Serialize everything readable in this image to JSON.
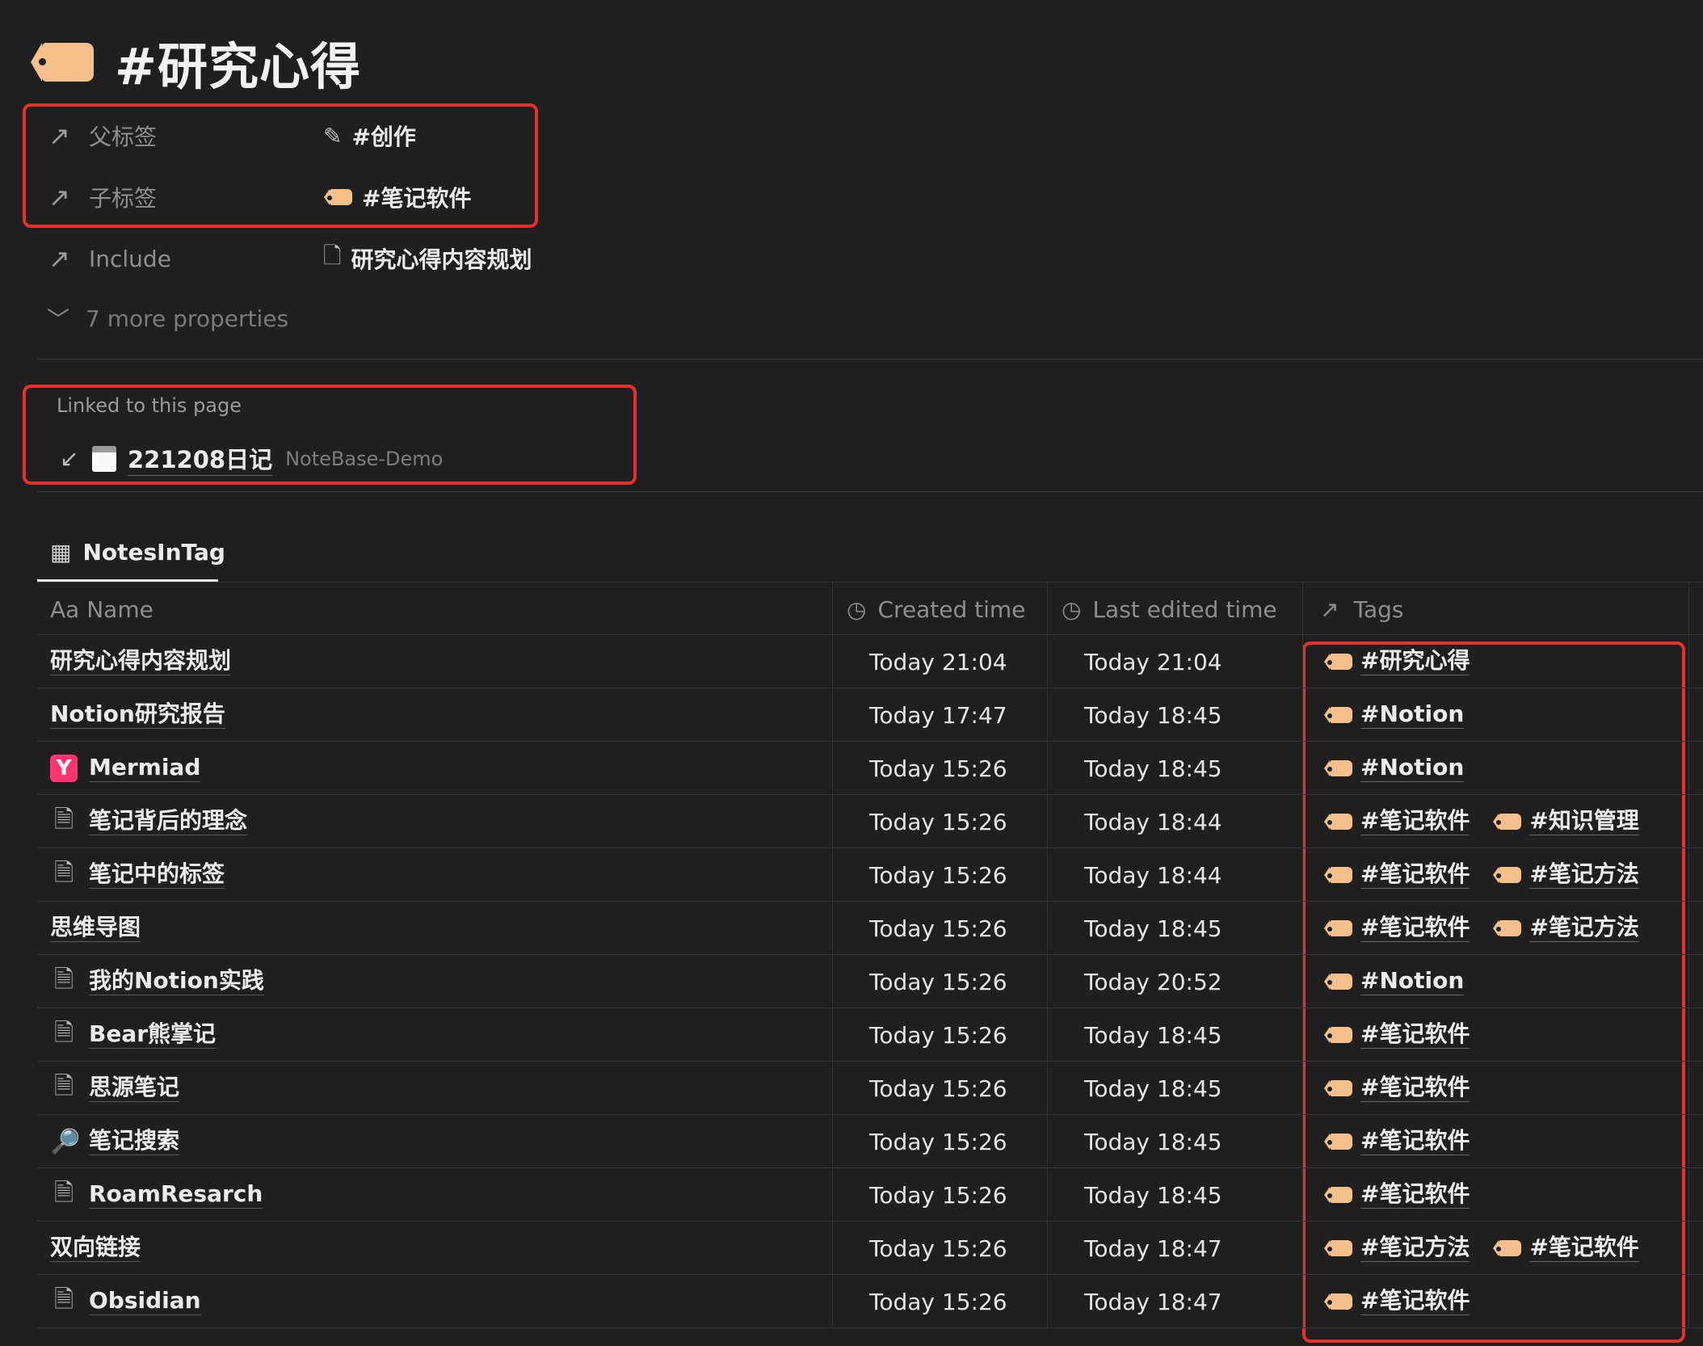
{
  "page": {
    "title": "#研究心得",
    "icon": "tag-icon"
  },
  "properties": [
    {
      "label": "父标签",
      "value": "#创作",
      "value_icon": "edit-icon"
    },
    {
      "label": "子标签",
      "value": "#笔记软件",
      "value_icon": "tag-icon"
    },
    {
      "label": "Include",
      "value": "研究心得内容规划",
      "value_icon": "page-icon"
    }
  ],
  "more_properties": "7 more properties",
  "linked": {
    "title": "Linked to this page",
    "item": {
      "page": "221208日记",
      "source": "NoteBase-Demo",
      "icon": "calendar-icon"
    }
  },
  "database": {
    "tab_label": "NotesInTag",
    "columns": {
      "name": "Aa Name",
      "created": "Created time",
      "edited": "Last edited time",
      "tags": "Tags"
    },
    "rows": [
      {
        "name": "研究心得内容规划",
        "icon": "none",
        "created": "Today 21:04",
        "edited": "Today 21:04",
        "tags": [
          "#研究心得"
        ]
      },
      {
        "name": "Notion研究报告",
        "icon": "none",
        "created": "Today 17:47",
        "edited": "Today 18:45",
        "tags": [
          "#Notion"
        ]
      },
      {
        "name": "Mermiad",
        "icon": "mermaid-logo-icon",
        "created": "Today 15:26",
        "edited": "Today 18:45",
        "tags": [
          "#Notion"
        ]
      },
      {
        "name": "笔记背后的理念",
        "icon": "document-icon",
        "created": "Today 15:26",
        "edited": "Today 18:44",
        "tags": [
          "#笔记软件",
          "#知识管理"
        ]
      },
      {
        "name": "笔记中的标签",
        "icon": "document-icon",
        "created": "Today 15:26",
        "edited": "Today 18:44",
        "tags": [
          "#笔记软件",
          "#笔记方法"
        ]
      },
      {
        "name": "思维导图",
        "icon": "none",
        "created": "Today 15:26",
        "edited": "Today 18:45",
        "tags": [
          "#笔记软件",
          "#笔记方法"
        ]
      },
      {
        "name": "我的Notion实践",
        "icon": "document-icon",
        "created": "Today 15:26",
        "edited": "Today 20:52",
        "tags": [
          "#Notion"
        ]
      },
      {
        "name": "Bear熊掌记",
        "icon": "document-icon",
        "created": "Today 15:26",
        "edited": "Today 18:45",
        "tags": [
          "#笔记软件"
        ]
      },
      {
        "name": "思源笔记",
        "icon": "document-icon",
        "created": "Today 15:26",
        "edited": "Today 18:45",
        "tags": [
          "#笔记软件"
        ]
      },
      {
        "name": "笔记搜索",
        "icon": "magnifier-icon",
        "created": "Today 15:26",
        "edited": "Today 18:45",
        "tags": [
          "#笔记软件"
        ]
      },
      {
        "name": "RoamResarch",
        "icon": "document-icon",
        "created": "Today 15:26",
        "edited": "Today 18:45",
        "tags": [
          "#笔记软件"
        ]
      },
      {
        "name": "双向链接",
        "icon": "none",
        "created": "Today 15:26",
        "edited": "Today 18:47",
        "tags": [
          "#笔记方法",
          "#笔记软件"
        ]
      },
      {
        "name": "Obsidian",
        "icon": "document-icon",
        "created": "Today 15:26",
        "edited": "Today 18:47",
        "tags": [
          "#笔记软件"
        ]
      }
    ]
  },
  "colors": {
    "background": "#1f1f1f",
    "tag": "#f5c08b",
    "highlight_box": "#e5302b"
  }
}
